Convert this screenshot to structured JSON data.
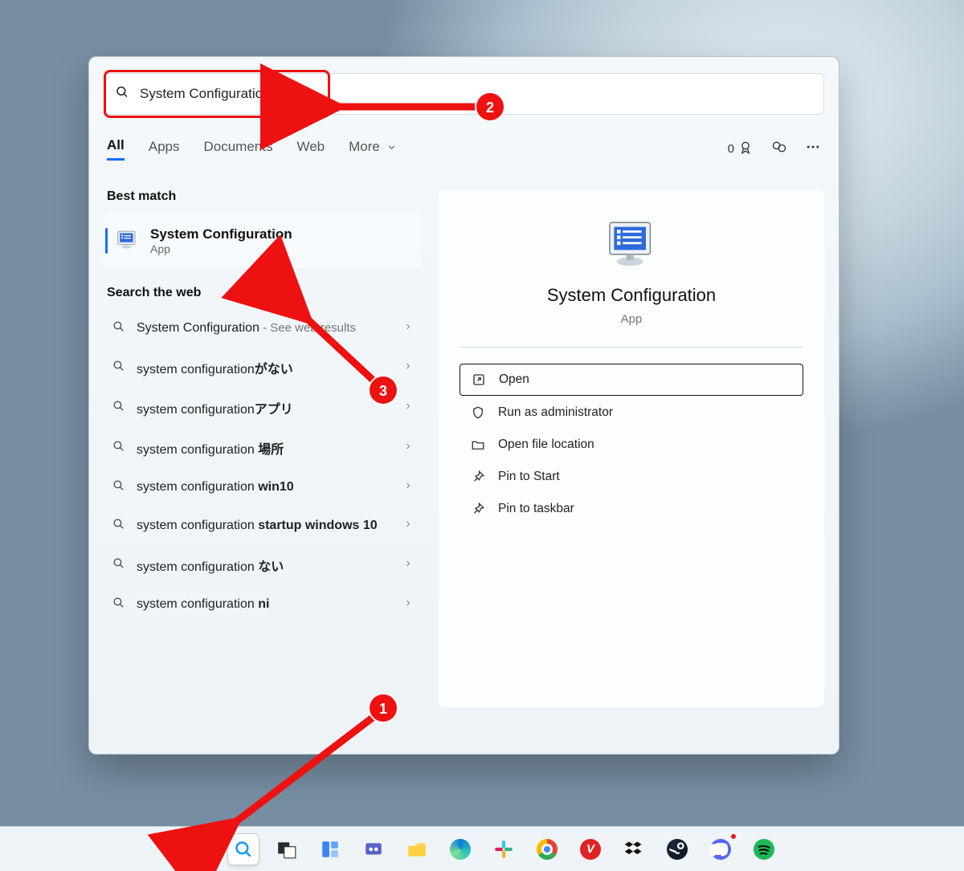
{
  "search": {
    "query": "System Configuration"
  },
  "tabs": {
    "all": "All",
    "apps": "Apps",
    "documents": "Documents",
    "web": "Web",
    "more": "More"
  },
  "rewards_count": "0",
  "left": {
    "best_label": "Best match",
    "best_title": "System Configuration",
    "best_sub": "App",
    "web_label": "Search the web",
    "items": [
      {
        "plain": "System Configuration",
        "hint": " - See web results"
      },
      {
        "plain": "system configuration",
        "bold": "がない"
      },
      {
        "plain": "system configuration",
        "bold": "アプリ"
      },
      {
        "plain": "system configuration  ",
        "bold": "場所"
      },
      {
        "plain": "system configuration ",
        "bold": "win10"
      },
      {
        "plain": "system configuration ",
        "bold": "startup windows 10"
      },
      {
        "plain": "system configuration  ",
        "bold": "ない"
      },
      {
        "plain": "system configuration ",
        "bold": "ni"
      }
    ]
  },
  "detail": {
    "title": "System Configuration",
    "sub": "App",
    "actions": {
      "open": "Open",
      "run_admin": "Run as administrator",
      "file_loc": "Open file location",
      "pin_start": "Pin to Start",
      "pin_taskbar": "Pin to taskbar"
    }
  },
  "markers": {
    "one": "1",
    "two": "2",
    "three": "3"
  }
}
